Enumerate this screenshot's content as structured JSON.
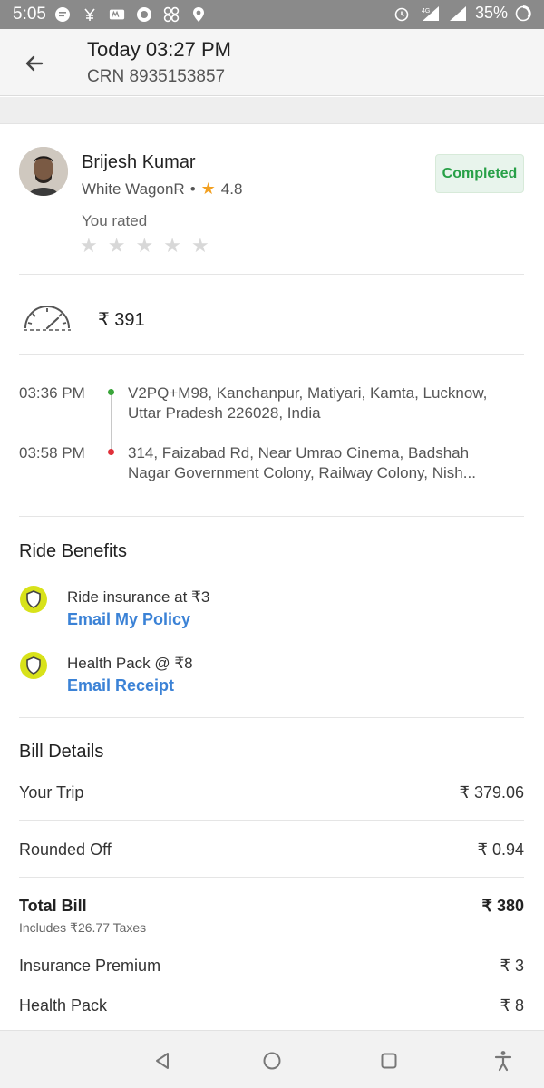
{
  "status_bar": {
    "time": "5:05",
    "net_label": "4G",
    "battery": "35%"
  },
  "header": {
    "title": "Today 03:27 PM",
    "crn": "CRN 8935153857"
  },
  "driver": {
    "name": "Brijesh  Kumar",
    "car": "White WagonR",
    "separator": "•",
    "rating": "4.8",
    "status": "Completed",
    "you_rated_label": "You rated",
    "user_rating_stars": 0
  },
  "fare": {
    "amount": "₹ 391"
  },
  "route": {
    "pickup": {
      "time": "03:36 PM",
      "address": "V2PQ+M98, Kanchanpur, Matiyari, Kamta, Lucknow, Uttar Pradesh 226028, India"
    },
    "drop": {
      "time": "03:58 PM",
      "address": "314, Faizabad Rd, Near Umrao Cinema, Badshah Nagar Government Colony, Railway Colony, Nish..."
    }
  },
  "benefits": {
    "title": "Ride Benefits",
    "items": [
      {
        "text": "Ride insurance at ₹3",
        "link": "Email My Policy"
      },
      {
        "text": "Health Pack @ ₹8",
        "link": "Email Receipt"
      }
    ]
  },
  "bill": {
    "title": "Bill Details",
    "your_trip": {
      "label": "Your Trip",
      "value": "₹ 379.06"
    },
    "rounded_off": {
      "label": "Rounded Off",
      "value": "₹ 0.94"
    },
    "total": {
      "label": "Total Bill",
      "value": "₹ 380",
      "note": "Includes ₹26.77 Taxes"
    },
    "insurance": {
      "label": "Insurance Premium",
      "value": "₹ 3"
    },
    "health_pack": {
      "label": "Health Pack",
      "value": "₹ 8"
    }
  },
  "colors": {
    "completed_green": "#27a047",
    "link_blue": "#3b82d6",
    "shield_yellow": "#d8e21a",
    "pickup_green": "#3aa53a",
    "drop_red": "#e0303a"
  }
}
